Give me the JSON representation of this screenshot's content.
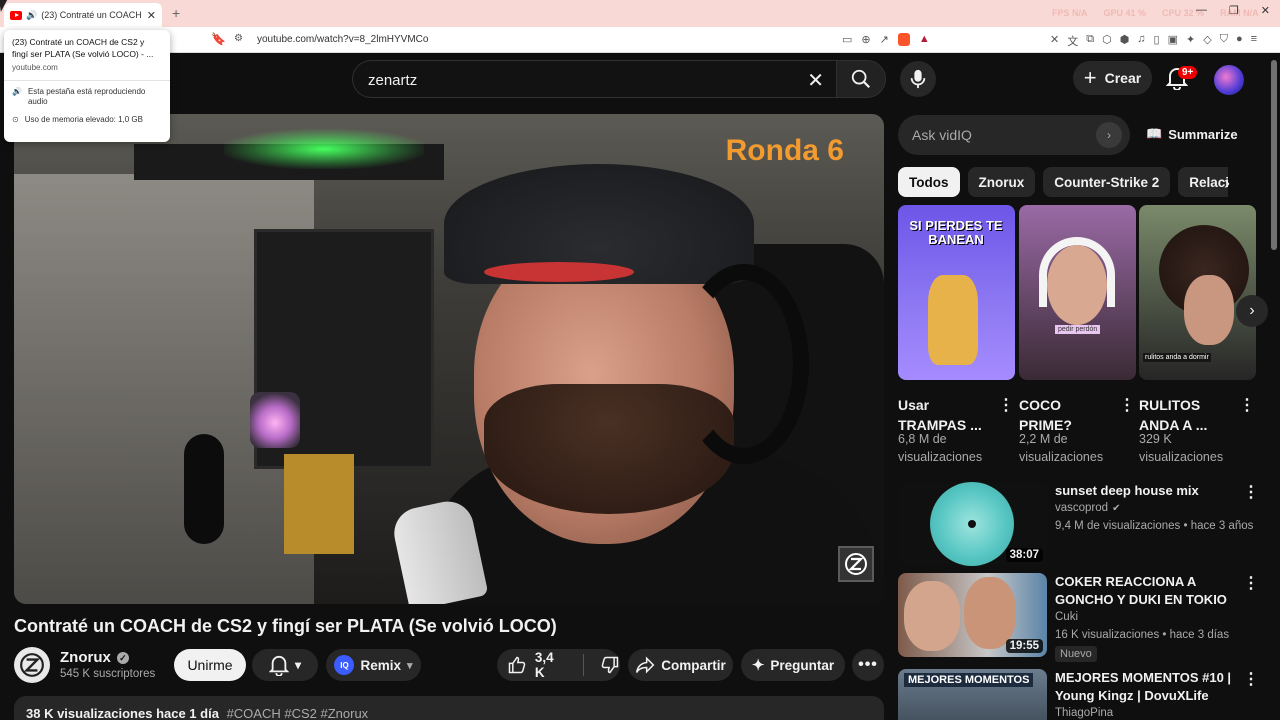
{
  "browser": {
    "tab_title": "(23) Contraté un COACH de CS2 y fingí ser PLATA (Se volvió LOCO)",
    "new_tab": "+",
    "url": "youtube.com/watch?v=8_2lmHYVMCo",
    "stats": [
      "FPS N/A",
      "GPU 41 %",
      "CPU 32 %",
      "RAM N/A"
    ],
    "window_buttons": [
      "—",
      "❐",
      "✕"
    ]
  },
  "tab_card": {
    "title": "(23) Contraté un COACH de CS2 y fingí ser PLATA (Se volvió LOCO) - ...",
    "domain": "youtube.com",
    "audio_note": "Esta pestaña está reproduciendo audio",
    "memory_note": "Uso de memoria elevado: 1,0 GB"
  },
  "header": {
    "search_query": "zenartz",
    "create_label": "Crear",
    "notif_count": "9+"
  },
  "video": {
    "overlay_text": "Ronda 6",
    "title": "Contraté un COACH de CS2 y fingí ser PLATA (Se volvió LOCO)",
    "channel": "Znorux",
    "subscribers": "545 K suscriptores",
    "join_label": "Unirme",
    "remix_label": "Remix",
    "iq_badge": "IQ",
    "likes": "3,4 K",
    "share_label": "Compartir",
    "ask_label": "Preguntar",
    "views_date": "38 K visualizaciones  hace 1 día",
    "tags": "#COACH #CS2 #Znorux"
  },
  "sidebar": {
    "vidiq_placeholder": "Ask vidIQ",
    "summarize_label": "Summarize",
    "chips": [
      "Todos",
      "Znorux",
      "Counter-Strike 2",
      "Relacionados"
    ],
    "shorts": [
      {
        "thumb_text": "SI PIERDES TE BANEAN",
        "title": "Usar TRAMPAS ...",
        "views": "6,8 M de visualizaciones"
      },
      {
        "thumb_text": "pedir perdón",
        "title": "COCO PRIME?",
        "views": "2,2 M de visualizaciones"
      },
      {
        "thumb_text": "rulitos anda a dormir",
        "title": "RULITOS ANDA A ...",
        "views": "329 K visualizaciones"
      }
    ],
    "recommended": [
      {
        "title": "sunset deep house mix",
        "channel": "vascoprod",
        "meta": "9,4 M de visualizaciones • hace 3 años",
        "duration": "38:07",
        "verified": true
      },
      {
        "title": "COKER REACCIONA A GONCHO Y DUKI EN TOKIO",
        "channel": "Cuki",
        "meta": "16 K visualizaciones • hace 3 días",
        "duration": "19:55",
        "badge": "Nuevo"
      },
      {
        "title": "MEJORES MOMENTOS #10 | Young Kingz | DovuXLife",
        "channel": "ThiagoPina",
        "thumb_text": "MEJORES MOMENTOS"
      }
    ]
  }
}
